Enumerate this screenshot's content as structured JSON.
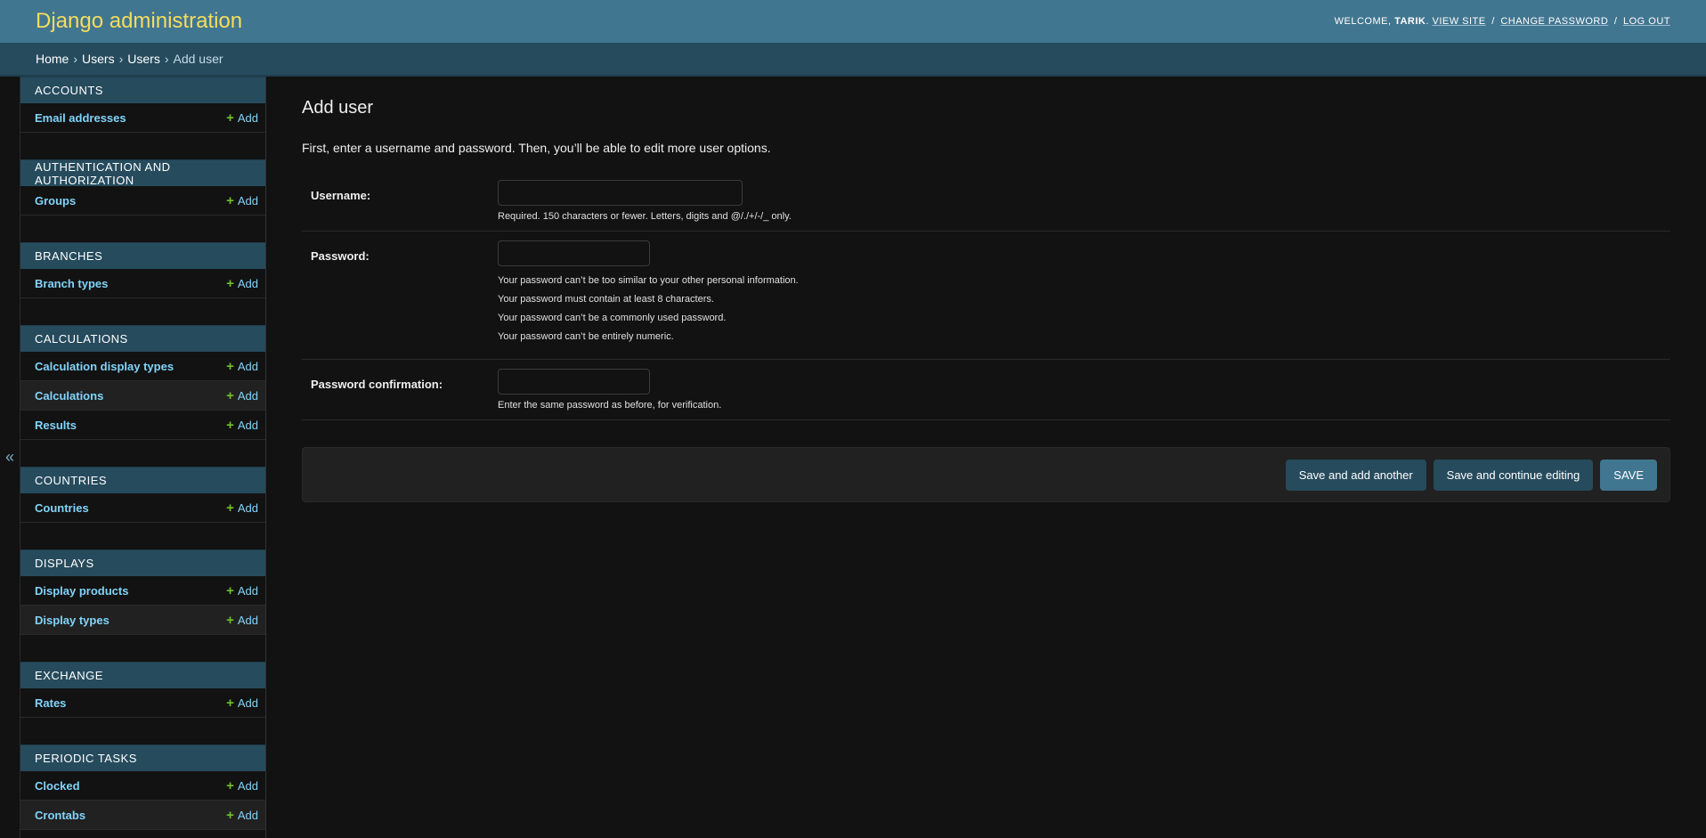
{
  "header": {
    "branding": "Django administration",
    "welcome": "Welcome,",
    "username": "Tarik",
    "view_site": "View site",
    "change_password": "Change password",
    "log_out": "Log out",
    "sep": "/"
  },
  "breadcrumbs": {
    "home": "Home",
    "app": "Users",
    "model": "Users",
    "current": "Add user",
    "sep": "›"
  },
  "nav_toggle": "«",
  "sidebar": {
    "add_label": "Add",
    "modules": [
      {
        "caption": "Accounts",
        "models": [
          "Email addresses"
        ]
      },
      {
        "caption": "Authentication and Authorization",
        "models": [
          "Groups"
        ]
      },
      {
        "caption": "Branches",
        "models": [
          "Branch types"
        ]
      },
      {
        "caption": "Calculations",
        "models": [
          "Calculation display types",
          "Calculations",
          "Results"
        ]
      },
      {
        "caption": "Countries",
        "models": [
          "Countries"
        ]
      },
      {
        "caption": "Displays",
        "models": [
          "Display products",
          "Display types"
        ]
      },
      {
        "caption": "Exchange",
        "models": [
          "Rates"
        ]
      },
      {
        "caption": "Periodic Tasks",
        "models": [
          "Clocked",
          "Crontabs"
        ]
      }
    ]
  },
  "content": {
    "title": "Add user",
    "intro": "First, enter a username and password. Then, you’ll be able to edit more user options.",
    "username": {
      "label": "Username:",
      "value": "",
      "help": "Required. 150 characters or fewer. Letters, digits and @/./+/-/_ only."
    },
    "password": {
      "label": "Password:",
      "value": "",
      "help": [
        "Your password can’t be too similar to your other personal information.",
        "Your password must contain at least 8 characters.",
        "Your password can’t be a commonly used password.",
        "Your password can’t be entirely numeric."
      ]
    },
    "password_confirmation": {
      "label": "Password confirmation:",
      "value": "",
      "help": "Enter the same password as before, for verification."
    },
    "buttons": {
      "save_add_another": "Save and add another",
      "save_continue": "Save and continue editing",
      "save": "Save"
    }
  },
  "colors": {
    "header_bg": "#417690",
    "branding": "#f5dd5d",
    "breadcrumbs_bg": "#264b5d",
    "link": "#81d4fa",
    "add_icon": "#70bf2b",
    "body_bg": "#121212"
  }
}
